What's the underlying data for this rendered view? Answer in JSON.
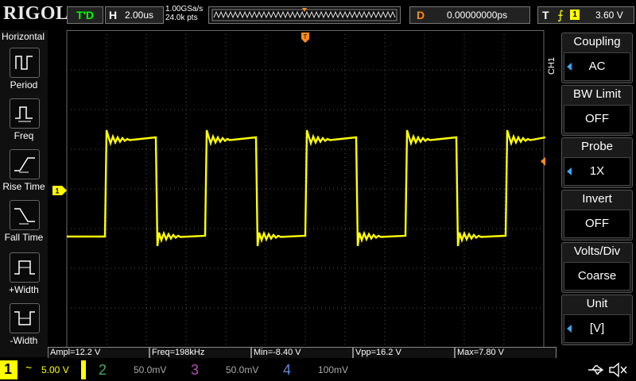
{
  "topbar": {
    "logo": "RIGOL",
    "status": "T'D",
    "horizontal": {
      "key": "H",
      "value": "2.00us"
    },
    "sample_rate": "1.00GSa/s",
    "points": "24.0k pts",
    "delay": {
      "key": "D",
      "value": "0.00000000ps"
    },
    "trigger": {
      "key": "T",
      "edge_icon": "rising-edge-icon",
      "channel": "1",
      "level": "3.60 V"
    }
  },
  "left_menu": {
    "title": "Horizontal",
    "items": [
      {
        "label": "Period",
        "icon": "period-icon"
      },
      {
        "label": "Freq",
        "icon": "freq-icon"
      },
      {
        "label": "Rise Time",
        "icon": "rise-time-icon"
      },
      {
        "label": "Fall Time",
        "icon": "fall-time-icon"
      },
      {
        "label": "+Width",
        "icon": "pos-width-icon"
      },
      {
        "label": "-Width",
        "icon": "neg-width-icon"
      }
    ]
  },
  "right_menu": {
    "channel_tag": "CH1",
    "items": [
      {
        "header": "Coupling",
        "value": "AC",
        "arrow": true
      },
      {
        "header": "BW Limit",
        "value": "OFF",
        "arrow": false
      },
      {
        "header": "Probe",
        "value": "1X",
        "arrow": true
      },
      {
        "header": "Invert",
        "value": "OFF",
        "arrow": false
      },
      {
        "header": "Volts/Div",
        "value": "Coarse",
        "arrow": false
      },
      {
        "header": "Unit",
        "value": "[V]",
        "arrow": true
      }
    ]
  },
  "measurements": [
    {
      "text": "Ampl=12.2 V"
    },
    {
      "text": "Freq=198kHz"
    },
    {
      "text": "Min=-8.40 V"
    },
    {
      "text": "Vpp=16.2 V"
    },
    {
      "text": "Max=7.80 V"
    }
  ],
  "channels": [
    {
      "num": "1",
      "coupling": "~",
      "scale": "5.00 V",
      "color": "#ffff00"
    },
    {
      "num": "2",
      "coupling": "",
      "scale": "50.0mV",
      "color": "#00ffff"
    },
    {
      "num": "3",
      "coupling": "",
      "scale": "50.0mV",
      "color": "#ff00ff"
    },
    {
      "num": "4",
      "coupling": "",
      "scale": "100mV",
      "color": "#1e90ff"
    }
  ],
  "markers": {
    "trigger_pos": "T",
    "ch1_ground": "1"
  },
  "colors": {
    "trace": "#ffff00",
    "grid": "#555555",
    "accent": "#ff8c1a",
    "menu_arrow": "#33aaff"
  }
}
